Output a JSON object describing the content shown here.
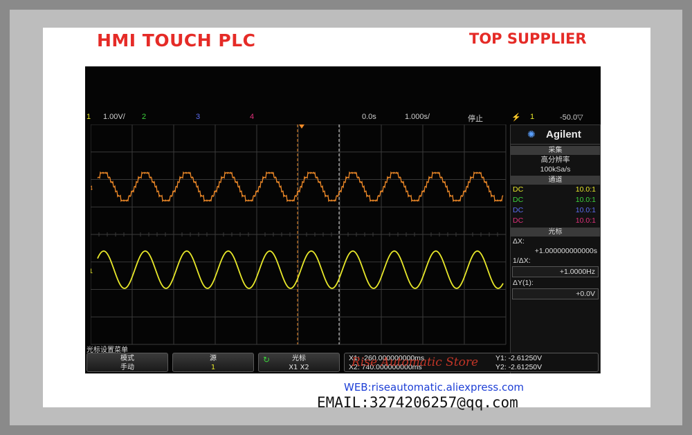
{
  "banner": {
    "left_text": "HMI TOUCH PLC",
    "right_text": "TOP SUPPLIER",
    "web_text": "WEB:riseautomatic.aliexpress.com",
    "email_text": "EMAIL:3274206257@qq.com",
    "watermark": "Rise Automatic Store",
    "accent_color": "#e52b27"
  },
  "status": {
    "ch1_num": "1",
    "ch1_scale": "1.00V/",
    "ch2_num": "2",
    "ch3_num": "3",
    "ch4_num": "4",
    "time_offset": "0.0s",
    "time_scale": "1.000s/",
    "run_state": "停止",
    "trigger_icon": "trigger-edge-icon",
    "trigger_channel": "1",
    "trigger_level": "-50.0▽"
  },
  "panel": {
    "brand": "Agilent",
    "acq_header": "采集",
    "acq_mode": "高分辨率",
    "sample_rate": "100kSa/s",
    "channel_header": "通道",
    "channels": [
      {
        "coupling": "DC",
        "ratio": "10.0:1",
        "color": "#e8e82a"
      },
      {
        "coupling": "DC",
        "ratio": "10.0:1",
        "color": "#3cd43c"
      },
      {
        "coupling": "DC",
        "ratio": "10.0:1",
        "color": "#5c6cf0"
      },
      {
        "coupling": "DC",
        "ratio": "10.0:1",
        "color": "#e0307a"
      }
    ],
    "cursor_header": "光标",
    "dx_label": "ΔX:",
    "dx_value": "+1.000000000000s",
    "inv_dx_label": "1/ΔX:",
    "inv_dx_value": "+1.0000Hz",
    "dy_label": "ΔY(1):",
    "dy_value": "+0.0V"
  },
  "menu": {
    "title": "光标设置菜单",
    "keys": [
      {
        "label": "模式",
        "value": "手动"
      },
      {
        "label": "源",
        "value": "1"
      },
      {
        "label": "光标",
        "value": "X1 X2"
      }
    ],
    "x1_text": "X1: -260.000000000ms",
    "x2_text": "X2: 740.000000000ms",
    "y1_text": "Y1: -2.61250V",
    "y2_text": "Y2: -2.61250V"
  },
  "traces": {
    "ch1_color": "#e8e82a",
    "ch4_color": "#f08a28"
  }
}
